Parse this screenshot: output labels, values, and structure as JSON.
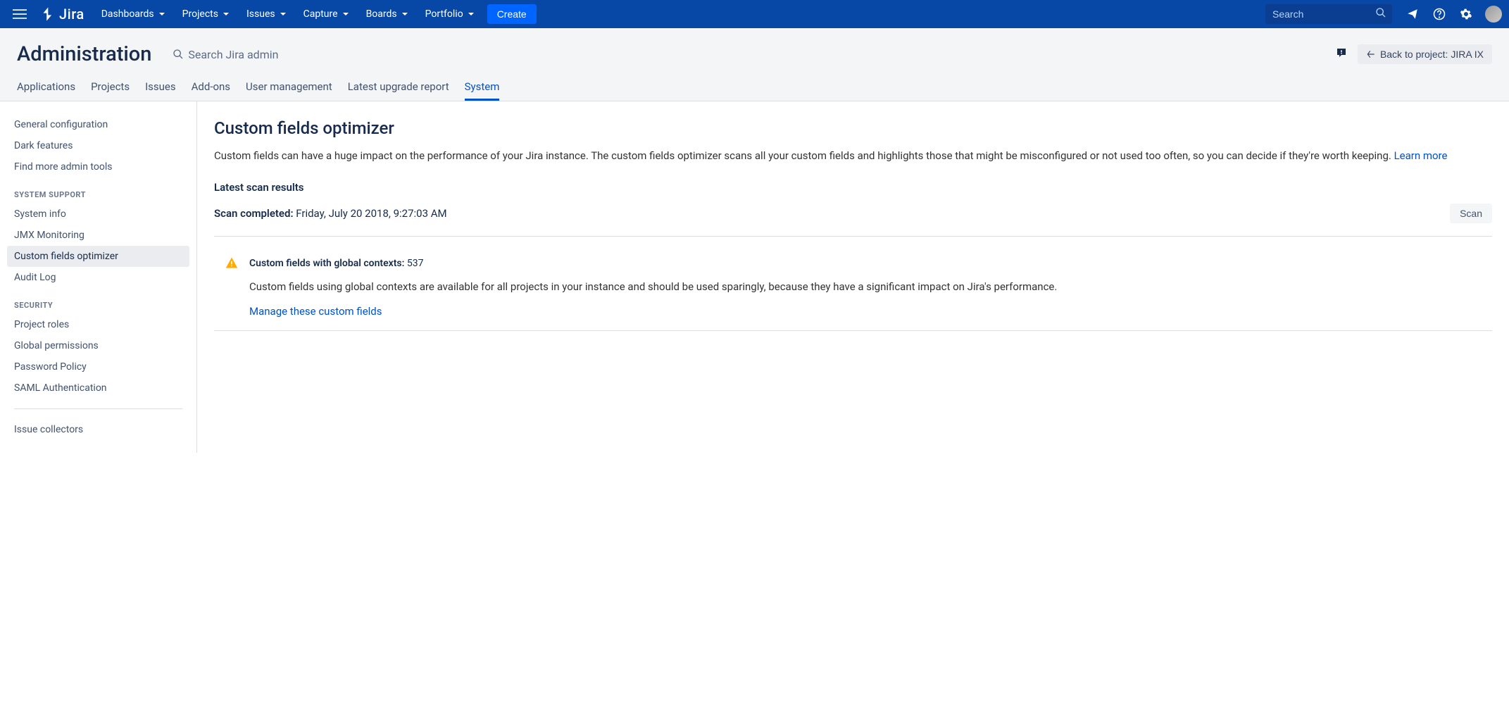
{
  "topnav": {
    "logo_text": "Jira",
    "items": [
      "Dashboards",
      "Projects",
      "Issues",
      "Capture",
      "Boards",
      "Portfolio"
    ],
    "create_label": "Create",
    "search_placeholder": "Search"
  },
  "admin": {
    "title": "Administration",
    "search_placeholder": "Search Jira admin",
    "back_label": "Back to project: JIRA IX",
    "tabs": [
      "Applications",
      "Projects",
      "Issues",
      "Add-ons",
      "User management",
      "Latest upgrade report",
      "System"
    ],
    "active_tab": "System"
  },
  "sidebar": {
    "top_items": [
      "General configuration",
      "Dark features",
      "Find more admin tools"
    ],
    "groups": [
      {
        "heading": "SYSTEM SUPPORT",
        "items": [
          "System info",
          "JMX Monitoring",
          "Custom fields optimizer",
          "Audit Log"
        ]
      },
      {
        "heading": "SECURITY",
        "items": [
          "Project roles",
          "Global permissions",
          "Password Policy",
          "SAML Authentication"
        ]
      }
    ],
    "bottom_items": [
      "Issue collectors"
    ],
    "active_item": "Custom fields optimizer"
  },
  "page": {
    "title": "Custom fields optimizer",
    "description": "Custom fields can have a huge impact on the performance of your Jira instance. The custom fields optimizer scans all your custom fields and highlights those that might be misconfigured or not used too often, so you can decide if they're worth keeping. ",
    "learn_more": "Learn more",
    "latest_scan_heading": "Latest scan results",
    "scan_completed_label": "Scan completed:",
    "scan_completed_time": "Friday, July 20 2018, 9:27:03 AM",
    "scan_button": "Scan",
    "result": {
      "heading_label": "Custom fields with global contexts:",
      "heading_count": "537",
      "body": "Custom fields using global contexts are available for all projects in your instance and should be used sparingly, because they have a significant impact on Jira's performance.",
      "link": "Manage these custom fields"
    }
  }
}
